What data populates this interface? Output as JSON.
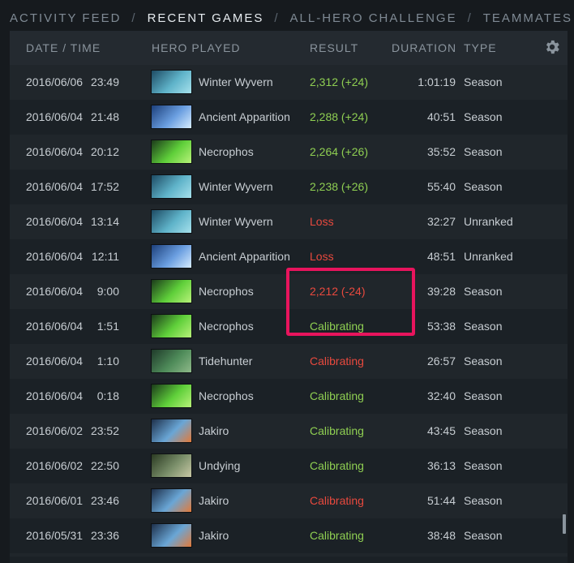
{
  "nav": {
    "tabs": [
      {
        "label": "ACTIVITY FEED",
        "active": false
      },
      {
        "label": "RECENT GAMES",
        "active": true
      },
      {
        "label": "ALL-HERO CHALLENGE",
        "active": false
      },
      {
        "label": "TEAMMATES",
        "active": false
      }
    ],
    "separator": "/"
  },
  "table": {
    "columns": {
      "date_time": "DATE / TIME",
      "hero": "HERO PLAYED",
      "result": "RESULT",
      "duration": "DURATION",
      "type": "TYPE"
    },
    "settings_icon": "gear-icon",
    "rows": [
      {
        "date": "2016/06/06",
        "time": "23:49",
        "hero": "Winter Wyvern",
        "hero_icon": "winter-wyvern",
        "result": "2,312 (+24)",
        "outcome": "win",
        "duration": "1:01:19",
        "type": "Season"
      },
      {
        "date": "2016/06/04",
        "time": "21:48",
        "hero": "Ancient Apparition",
        "hero_icon": "ancient-apparition",
        "result": "2,288 (+24)",
        "outcome": "win",
        "duration": "40:51",
        "type": "Season"
      },
      {
        "date": "2016/06/04",
        "time": "20:12",
        "hero": "Necrophos",
        "hero_icon": "necrophos",
        "result": "2,264 (+26)",
        "outcome": "win",
        "duration": "35:52",
        "type": "Season"
      },
      {
        "date": "2016/06/04",
        "time": "17:52",
        "hero": "Winter Wyvern",
        "hero_icon": "winter-wyvern",
        "result": "2,238 (+26)",
        "outcome": "win",
        "duration": "55:40",
        "type": "Season"
      },
      {
        "date": "2016/06/04",
        "time": "13:14",
        "hero": "Winter Wyvern",
        "hero_icon": "winter-wyvern",
        "result": "Loss",
        "outcome": "loss",
        "duration": "32:27",
        "type": "Unranked"
      },
      {
        "date": "2016/06/04",
        "time": "12:11",
        "hero": "Ancient Apparition",
        "hero_icon": "ancient-apparition",
        "result": "Loss",
        "outcome": "loss",
        "duration": "48:51",
        "type": "Unranked"
      },
      {
        "date": "2016/06/04",
        "time": "9:00",
        "hero": "Necrophos",
        "hero_icon": "necrophos",
        "result": "2,212 (-24)",
        "outcome": "loss",
        "duration": "39:28",
        "type": "Season"
      },
      {
        "date": "2016/06/04",
        "time": "1:51",
        "hero": "Necrophos",
        "hero_icon": "necrophos",
        "result": "Calibrating",
        "outcome": "win",
        "duration": "53:38",
        "type": "Season"
      },
      {
        "date": "2016/06/04",
        "time": "1:10",
        "hero": "Tidehunter",
        "hero_icon": "tidehunter",
        "result": "Calibrating",
        "outcome": "loss",
        "duration": "26:57",
        "type": "Season"
      },
      {
        "date": "2016/06/04",
        "time": "0:18",
        "hero": "Necrophos",
        "hero_icon": "necrophos",
        "result": "Calibrating",
        "outcome": "win",
        "duration": "32:40",
        "type": "Season"
      },
      {
        "date": "2016/06/02",
        "time": "23:52",
        "hero": "Jakiro",
        "hero_icon": "jakiro",
        "result": "Calibrating",
        "outcome": "win",
        "duration": "43:45",
        "type": "Season"
      },
      {
        "date": "2016/06/02",
        "time": "22:50",
        "hero": "Undying",
        "hero_icon": "undying",
        "result": "Calibrating",
        "outcome": "win",
        "duration": "36:13",
        "type": "Season"
      },
      {
        "date": "2016/06/01",
        "time": "23:46",
        "hero": "Jakiro",
        "hero_icon": "jakiro",
        "result": "Calibrating",
        "outcome": "loss",
        "duration": "51:44",
        "type": "Season"
      },
      {
        "date": "2016/05/31",
        "time": "23:36",
        "hero": "Jakiro",
        "hero_icon": "jakiro",
        "result": "Calibrating",
        "outcome": "win",
        "duration": "38:48",
        "type": "Season"
      }
    ]
  },
  "colors": {
    "win": "#8fcf52",
    "loss": "#e8493e",
    "highlight": "#e8145d",
    "background": "#161a1e"
  },
  "hero_palettes": {
    "winter-wyvern": [
      "#1d4a63",
      "#5fb3c9",
      "#a6e1ec"
    ],
    "ancient-apparition": [
      "#1c3f7a",
      "#6a9ee0",
      "#d6ecff"
    ],
    "necrophos": [
      "#1b3a1a",
      "#5fcf3a",
      "#b8f27a"
    ],
    "tidehunter": [
      "#1f3a2a",
      "#4f8c5a",
      "#8fb98a"
    ],
    "jakiro": [
      "#1d2f4a",
      "#6aa6d6",
      "#e27a3a"
    ],
    "undying": [
      "#2a3a22",
      "#7a8f6a",
      "#c9c9a6"
    ]
  }
}
